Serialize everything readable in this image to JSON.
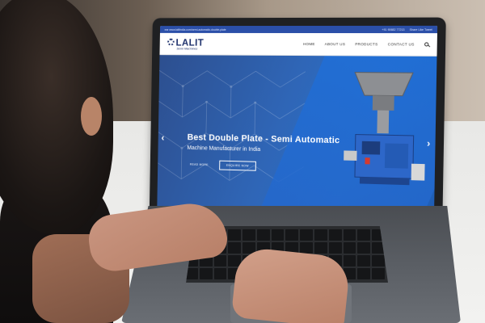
{
  "website": {
    "topbar": {
      "url_text": "ear www.lalitindia.com/semi-automatic-double-plate",
      "phone": "+91 90682 77213",
      "social": "Share   Like   Tweet"
    },
    "logo": {
      "name": "LALIT",
      "tagline": "Semi Machines"
    },
    "menu": [
      "HOME",
      "ABOUT US",
      "PRODUCTS",
      "CONTACT US"
    ],
    "hero": {
      "title": "Best Double Plate - Semi Automatic",
      "subtitle": "Machine Manufacturer in India",
      "read_more": "READ MORE",
      "enquire": "ENQUIRE NOW",
      "prev_arrow": "‹",
      "next_arrow": "›"
    }
  },
  "colors": {
    "topbar": "#2b4fa8",
    "hero": "#2f66b7",
    "logo": "#1c2f6b"
  }
}
